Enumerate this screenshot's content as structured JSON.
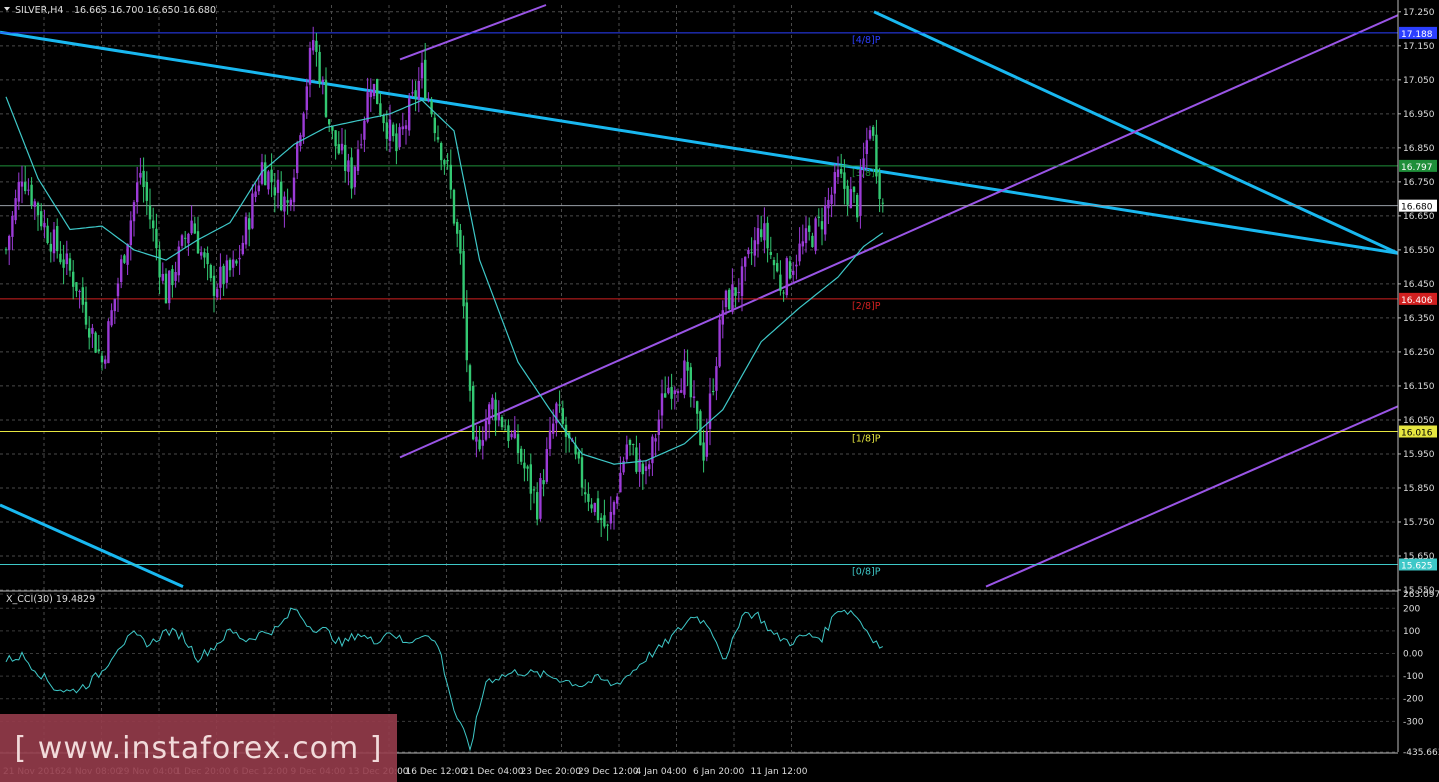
{
  "header": {
    "symbol": "SILVER,H4",
    "ohlc": "16.665 16.700 16.650 16.680"
  },
  "watermark": "[ www.instaforex.com ]",
  "chart_data": [
    {
      "type": "candlestick",
      "title": "SILVER,H4",
      "ylim": [
        15.55,
        17.27
      ],
      "y_ticks": [
        "17.250",
        "17.150",
        "17.050",
        "16.950",
        "16.850",
        "16.750",
        "16.650",
        "16.550",
        "16.450",
        "16.350",
        "16.250",
        "16.150",
        "16.050",
        "15.950",
        "15.850",
        "15.750",
        "15.650",
        "15.550"
      ],
      "x_ticks": [
        "21 Nov 2016",
        "24 Nov 08:00",
        "29 Nov 04:00",
        "1 Dec 20:00",
        "6 Dec 12:00",
        "9 Dec 04:00",
        "13 Dec 20:00",
        "16 Dec 12:00",
        "21 Dec 04:00",
        "23 Dec 20:00",
        "29 Dec 12:00",
        "4 Jan 04:00",
        "6 Jan 20:00",
        "11 Jan 12:00"
      ],
      "bull_color": "#9b3bd6",
      "bear_color": "#33c872",
      "close_anchors": [
        [
          0,
          16.55
        ],
        [
          5,
          16.78
        ],
        [
          12,
          16.62
        ],
        [
          22,
          16.45
        ],
        [
          30,
          16.22
        ],
        [
          37,
          16.55
        ],
        [
          42,
          16.78
        ],
        [
          50,
          16.42
        ],
        [
          58,
          16.64
        ],
        [
          64,
          16.44
        ],
        [
          72,
          16.5
        ],
        [
          80,
          16.8
        ],
        [
          88,
          16.68
        ],
        [
          96,
          17.17
        ],
        [
          102,
          16.88
        ],
        [
          108,
          16.76
        ],
        [
          114,
          17.05
        ],
        [
          122,
          16.84
        ],
        [
          130,
          17.07
        ],
        [
          138,
          16.78
        ],
        [
          142,
          16.52
        ],
        [
          146,
          15.95
        ],
        [
          152,
          16.1
        ],
        [
          160,
          15.96
        ],
        [
          166,
          15.8
        ],
        [
          172,
          16.08
        ],
        [
          180,
          15.87
        ],
        [
          188,
          15.72
        ],
        [
          194,
          15.98
        ],
        [
          200,
          15.88
        ],
        [
          206,
          16.14
        ],
        [
          212,
          16.19
        ],
        [
          218,
          15.96
        ],
        [
          224,
          16.38
        ],
        [
          230,
          16.46
        ],
        [
          236,
          16.62
        ],
        [
          242,
          16.45
        ],
        [
          248,
          16.55
        ],
        [
          254,
          16.62
        ],
        [
          260,
          16.76
        ],
        [
          266,
          16.68
        ],
        [
          270,
          16.93
        ],
        [
          274,
          16.68
        ]
      ],
      "moving_average": {
        "period_anchors": [
          [
            0,
            17.0
          ],
          [
            10,
            16.76
          ],
          [
            20,
            16.61
          ],
          [
            30,
            16.62
          ],
          [
            40,
            16.55
          ],
          [
            50,
            16.52
          ],
          [
            60,
            16.58
          ],
          [
            70,
            16.63
          ],
          [
            80,
            16.78
          ],
          [
            90,
            16.86
          ],
          [
            100,
            16.91
          ],
          [
            110,
            16.93
          ],
          [
            120,
            16.95
          ],
          [
            130,
            16.99
          ],
          [
            140,
            16.9
          ],
          [
            148,
            16.52
          ],
          [
            160,
            16.22
          ],
          [
            170,
            16.08
          ],
          [
            180,
            15.95
          ],
          [
            190,
            15.92
          ],
          [
            200,
            15.93
          ],
          [
            212,
            15.98
          ],
          [
            224,
            16.08
          ],
          [
            236,
            16.28
          ],
          [
            248,
            16.38
          ],
          [
            260,
            16.47
          ],
          [
            268,
            16.56
          ],
          [
            274,
            16.6
          ]
        ],
        "color": "#3ec8c8"
      },
      "levels": [
        {
          "label": "[4/8]P",
          "value": 17.188,
          "price_label": "17.188",
          "color": "#2b3fff"
        },
        {
          "label": "[3/8]P",
          "value": 16.797,
          "price_label": "16.797",
          "color": "#1f8f3a"
        },
        {
          "label": "[2/8]P",
          "value": 16.406,
          "price_label": "16.406",
          "color": "#d12020"
        },
        {
          "label": "[1/8]P",
          "value": 16.016,
          "price_label": "16.016",
          "color": "#e6e640"
        },
        {
          "label": "[0/8]P",
          "value": 15.625,
          "price_label": "15.625",
          "color": "#3ec8c8"
        }
      ],
      "current_price": {
        "value": 16.68,
        "label": "16.680"
      },
      "trend_channels": [
        {
          "name": "descending channel",
          "color": "#19b8f0",
          "lines": [
            [
              [
                0,
                17.19
              ],
              [
                1398,
                16.54
              ]
            ],
            [
              [
                0,
                15.8
              ],
              [
                183,
                15.56
              ]
            ],
            [
              [
                874,
                17.25
              ],
              [
                1398,
                16.54
              ]
            ]
          ]
        },
        {
          "name": "ascending channel",
          "color": "#9a55e6",
          "lines": [
            [
              [
                400,
                15.94
              ],
              [
                1398,
                17.24
              ]
            ],
            [
              [
                400,
                17.11
              ],
              [
                546,
                17.27
              ]
            ],
            [
              [
                986,
                15.56
              ],
              [
                1398,
                16.09
              ]
            ]
          ]
        }
      ]
    },
    {
      "type": "line",
      "title": "X_CCI(30) 19.4829",
      "indicator": "X_CCI(30)",
      "value_label": "19.4829",
      "ylim": [
        -435.663,
        263.0977
      ],
      "y_ticks": [
        "263.0977",
        "200",
        "100",
        "0.00",
        "-100",
        "-200",
        "-300",
        "-435.663"
      ],
      "color": "#3ec8c8",
      "anchors": [
        [
          0,
          -30
        ],
        [
          5,
          -10
        ],
        [
          10,
          -80
        ],
        [
          15,
          -150
        ],
        [
          20,
          -170
        ],
        [
          25,
          -140
        ],
        [
          30,
          -80
        ],
        [
          35,
          30
        ],
        [
          40,
          80
        ],
        [
          45,
          40
        ],
        [
          50,
          100
        ],
        [
          55,
          80
        ],
        [
          60,
          -20
        ],
        [
          65,
          30
        ],
        [
          70,
          100
        ],
        [
          75,
          60
        ],
        [
          80,
          90
        ],
        [
          85,
          110
        ],
        [
          90,
          200
        ],
        [
          95,
          120
        ],
        [
          100,
          100
        ],
        [
          105,
          40
        ],
        [
          110,
          90
        ],
        [
          115,
          50
        ],
        [
          120,
          100
        ],
        [
          125,
          40
        ],
        [
          130,
          90
        ],
        [
          135,
          40
        ],
        [
          140,
          -250
        ],
        [
          145,
          -420
        ],
        [
          150,
          -120
        ],
        [
          160,
          -80
        ],
        [
          170,
          -100
        ],
        [
          180,
          -140
        ],
        [
          185,
          -110
        ],
        [
          190,
          -140
        ],
        [
          195,
          -90
        ],
        [
          200,
          -20
        ],
        [
          205,
          30
        ],
        [
          210,
          100
        ],
        [
          215,
          170
        ],
        [
          220,
          120
        ],
        [
          225,
          -40
        ],
        [
          230,
          180
        ],
        [
          235,
          170
        ],
        [
          240,
          80
        ],
        [
          245,
          50
        ],
        [
          250,
          80
        ],
        [
          255,
          70
        ],
        [
          260,
          200
        ],
        [
          265,
          180
        ],
        [
          268,
          120
        ],
        [
          272,
          50
        ],
        [
          274,
          19
        ]
      ]
    }
  ]
}
